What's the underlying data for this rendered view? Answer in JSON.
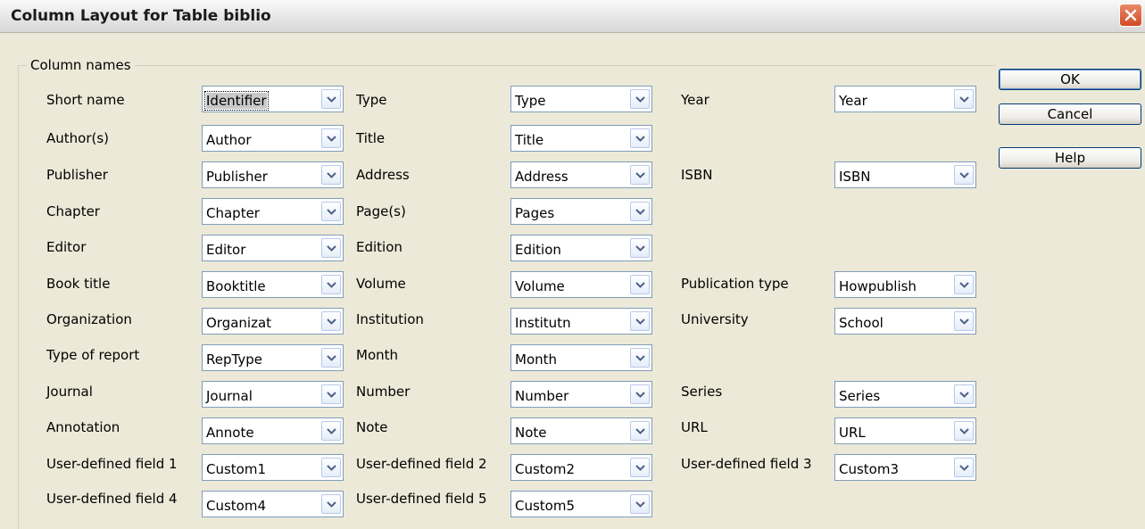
{
  "window": {
    "title": "Column Layout for Table biblio",
    "close_icon": "close-icon"
  },
  "group": {
    "label": "Column names"
  },
  "buttons": {
    "ok": "OK",
    "cancel": "Cancel",
    "help": "Help"
  },
  "fields": {
    "short_name": {
      "label": "Short name",
      "value": "Identifier"
    },
    "type": {
      "label": "Type",
      "value": "Type"
    },
    "year": {
      "label": "Year",
      "value": "Year"
    },
    "authors": {
      "label": "Author(s)",
      "value": "Author"
    },
    "title": {
      "label": "Title",
      "value": "Title"
    },
    "publisher": {
      "label": "Publisher",
      "value": "Publisher"
    },
    "address": {
      "label": "Address",
      "value": "Address"
    },
    "isbn": {
      "label": "ISBN",
      "value": "ISBN"
    },
    "chapter": {
      "label": "Chapter",
      "value": "Chapter"
    },
    "pages": {
      "label": "Page(s)",
      "value": "Pages"
    },
    "editor": {
      "label": "Editor",
      "value": "Editor"
    },
    "edition": {
      "label": "Edition",
      "value": "Edition"
    },
    "book_title": {
      "label": "Book title",
      "value": "Booktitle"
    },
    "volume": {
      "label": "Volume",
      "value": "Volume"
    },
    "publication_type": {
      "label": "Publication type",
      "value": "Howpublish"
    },
    "organization": {
      "label": "Organization",
      "value": "Organizat"
    },
    "institution": {
      "label": "Institution",
      "value": "Institutn"
    },
    "university": {
      "label": "University",
      "value": "School"
    },
    "type_of_report": {
      "label": "Type of report",
      "value": "RepType"
    },
    "month": {
      "label": "Month",
      "value": "Month"
    },
    "journal": {
      "label": "Journal",
      "value": "Journal"
    },
    "number": {
      "label": "Number",
      "value": "Number"
    },
    "series": {
      "label": "Series",
      "value": "Series"
    },
    "annotation": {
      "label": "Annotation",
      "value": "Annote"
    },
    "note": {
      "label": "Note",
      "value": "Note"
    },
    "url": {
      "label": "URL",
      "value": "URL"
    },
    "custom1": {
      "label": "User-defined field 1",
      "value": "Custom1"
    },
    "custom2": {
      "label": "User-defined field 2",
      "value": "Custom2"
    },
    "custom3": {
      "label": "User-defined field 3",
      "value": "Custom3"
    },
    "custom4": {
      "label": "User-defined field 4",
      "value": "Custom4"
    },
    "custom5": {
      "label": "User-defined field 5",
      "value": "Custom5"
    }
  }
}
